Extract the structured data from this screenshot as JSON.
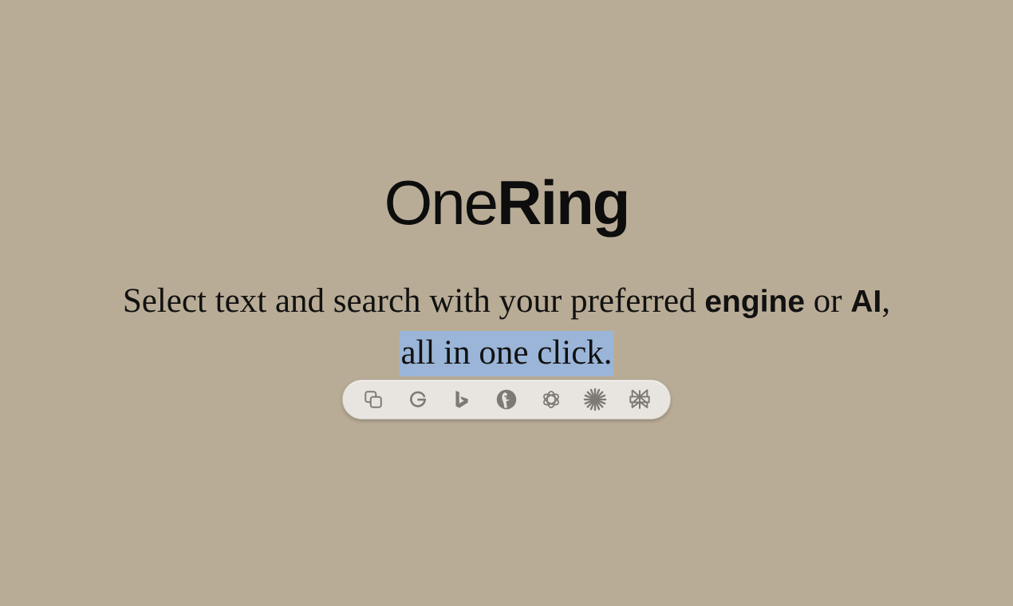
{
  "logo": {
    "part_light": "One",
    "part_bold": "Ring"
  },
  "tagline": {
    "segment_1": "Select text and search with your preferred ",
    "emphasis_1": "engine",
    "segment_2": " or ",
    "emphasis_2": "AI",
    "segment_3": ",",
    "selected_text": "all in one click."
  },
  "toolbar": {
    "icon_color": "#7d7a76",
    "items": [
      {
        "icon": "copy-icon"
      },
      {
        "icon": "google-icon"
      },
      {
        "icon": "bing-icon"
      },
      {
        "icon": "duckduckgo-icon"
      },
      {
        "icon": "chatgpt-icon"
      },
      {
        "icon": "claude-icon"
      },
      {
        "icon": "perplexity-icon"
      }
    ]
  },
  "colors": {
    "background": "#b9ac96",
    "selection_highlight": "#9ab5d7",
    "toolbar_background": "#e8e5e0"
  }
}
